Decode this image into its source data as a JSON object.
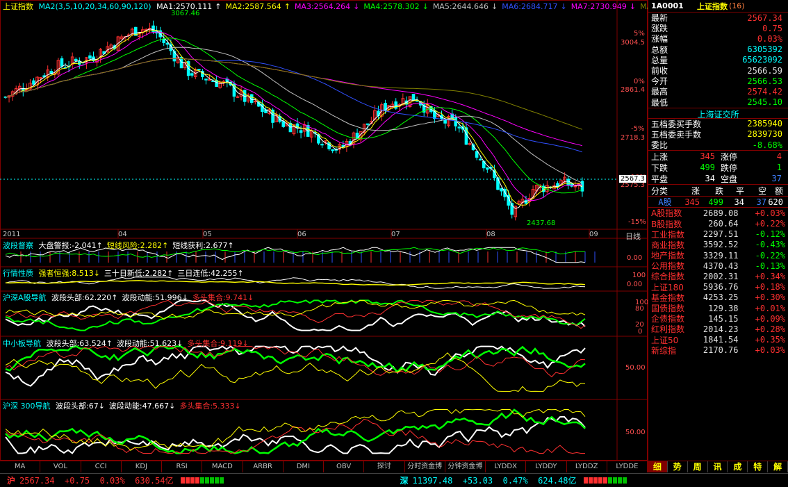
{
  "main_chart": {
    "title": "上证指数",
    "ma_params": "MA2(3,5,10,20,34,60,90,120)",
    "ma_items": [
      {
        "label": "MA1:2570.111",
        "arrow": "↑",
        "color": "#ffffff"
      },
      {
        "label": "MA2:2587.564",
        "arrow": "↑",
        "color": "#ffff00"
      },
      {
        "label": "MA3:2564.264",
        "arrow": "↓",
        "color": "#ff00ff"
      },
      {
        "label": "MA4:2578.302",
        "arrow": "↓",
        "color": "#00ff00"
      },
      {
        "label": "MA5:2644.646",
        "arrow": "↓",
        "color": "#c0c0c0"
      },
      {
        "label": "MA6:2684.717",
        "arrow": "↓",
        "color": "#3050ff"
      },
      {
        "label": "MA7:2730.949",
        "arrow": "↓",
        "color": "#ff00ff"
      },
      {
        "label": "MA8:2792.803",
        "arrow": "↓",
        "color": "#808000"
      }
    ],
    "high_mark": "3067.46",
    "low_mark": "2437.68",
    "current_mark": "2567.3",
    "y_ticks": [
      {
        "pct": "5%",
        "price": "3004.5"
      },
      {
        "pct": "0%",
        "price": "2861.4"
      },
      {
        "pct": "-5%",
        "price": "2718.3"
      },
      {
        "pct": "-10%",
        "price": "2575.3"
      },
      {
        "pct": "-15%",
        "price": ""
      }
    ],
    "date_labels": [
      "2011",
      "04",
      "05",
      "06",
      "07",
      "08",
      "09"
    ],
    "axis_suffix": "日线"
  },
  "panels": {
    "bodo": {
      "title": "波段督察",
      "items": [
        {
          "label": "大盘警报:-2.041",
          "arrow": "↑",
          "color": "#ffffff"
        },
        {
          "label": "短线风险:2.282",
          "arrow": "↑",
          "color": "#ffff00"
        },
        {
          "label": "短线获利:2.677",
          "arrow": "↑",
          "color": "#ffffff"
        }
      ],
      "axis": "0.00"
    },
    "hangqing": {
      "title": "行情性质",
      "items": [
        {
          "label": "强者恒强:8.513",
          "arrow": "↓",
          "color": "#ffff00"
        },
        {
          "label": "三十日新低:2.282",
          "arrow": "↑",
          "color": "#ffffff"
        },
        {
          "label": "三日连低:42.255",
          "arrow": "↑",
          "color": "#ffffff"
        }
      ],
      "axis": [
        "100",
        "0.00"
      ]
    },
    "hushen_a": {
      "title": "沪深A股导航",
      "items": [
        {
          "label": "波段头部:62.220",
          "arrow": "↑",
          "color": "#ffffff"
        },
        {
          "label": "波段动能:51.996",
          "arrow": "↓",
          "color": "#ffffff"
        },
        {
          "label": "多头集合:9.741",
          "arrow": "↓",
          "color": "#ff3030"
        }
      ],
      "axis": [
        "100",
        "80",
        "20",
        "0"
      ]
    },
    "zhongxiao": {
      "title": "中小板导航",
      "items": [
        {
          "label": "波段头部:63.524",
          "arrow": "↑",
          "color": "#ffffff"
        },
        {
          "label": "波段动能:51.623",
          "arrow": "↓",
          "color": "#ffffff"
        },
        {
          "label": "多头集合:9.119",
          "arrow": "↓",
          "color": "#ff3030"
        }
      ],
      "axis": "50.00"
    },
    "hs300": {
      "title": "沪深 300导航",
      "items": [
        {
          "label": "波段头部:67",
          "arrow": "↓",
          "color": "#ffffff"
        },
        {
          "label": "波段动能:47.667",
          "arrow": "↓",
          "color": "#ffffff"
        },
        {
          "label": "多头集合:5.333",
          "arrow": "↓",
          "color": "#ff3030"
        }
      ],
      "axis": "50.00"
    }
  },
  "quote": {
    "code": "1A0001",
    "name": "上证指数",
    "count": "(16)",
    "rows": [
      {
        "label": "最新",
        "value": "2567.34",
        "color": "#ff3030"
      },
      {
        "label": "涨跌",
        "value": "0.75",
        "color": "#ff3030"
      },
      {
        "label": "涨幅",
        "value": "0.03%",
        "color": "#ff3030"
      },
      {
        "label": "总额",
        "value": "6305392",
        "color": "#00ffff"
      },
      {
        "label": "总量",
        "value": "65623092",
        "color": "#00ffff"
      },
      {
        "label": "前收",
        "value": "2566.59",
        "color": "#e0e0e0"
      },
      {
        "label": "今开",
        "value": "2566.53",
        "color": "#00ff00"
      },
      {
        "label": "最高",
        "value": "2574.42",
        "color": "#ff3030"
      },
      {
        "label": "最低",
        "value": "2545.10",
        "color": "#00ff00"
      }
    ],
    "exchange": "上海证交所",
    "orders": [
      {
        "label": "五档委买手数",
        "value": "2385940",
        "color": "#ffff00"
      },
      {
        "label": "五档委卖手数",
        "value": "2839730",
        "color": "#ffff00"
      },
      {
        "label": "委比",
        "value": "-8.68%",
        "color": "#00ff00"
      }
    ],
    "updown": [
      {
        "l1": "上涨",
        "v1": "345",
        "c1": "#ff3030",
        "l2": "涨停",
        "v2": "4",
        "c2": "#ff3030"
      },
      {
        "l1": "下跌",
        "v1": "499",
        "c1": "#00ff00",
        "l2": "跌停",
        "v2": "1",
        "c2": "#00ff00"
      },
      {
        "l1": "平盘",
        "v1": "34",
        "c1": "#ffffff",
        "l2": "空盘",
        "v2": "37",
        "c2": "#4080ff"
      }
    ],
    "class_header": [
      "分类",
      "涨",
      "跌",
      "平",
      "空",
      "额"
    ],
    "class_row": {
      "label": "A股",
      "up": "345",
      "down": "499",
      "flat": "34",
      "empty": "37",
      "amount": "620"
    },
    "indices": [
      {
        "name": "A股指数",
        "value": "2689.08",
        "pct": "+0.03%"
      },
      {
        "name": "B股指数",
        "value": "260.64",
        "pct": "+0.22%"
      },
      {
        "name": "工业指数",
        "value": "2297.51",
        "pct": "-0.12%"
      },
      {
        "name": "商业指数",
        "value": "3592.52",
        "pct": "-0.43%"
      },
      {
        "name": "地产指数",
        "value": "3329.11",
        "pct": "-0.22%"
      },
      {
        "name": "公用指数",
        "value": "4370.43",
        "pct": "-0.13%"
      },
      {
        "name": "综合指数",
        "value": "2002.31",
        "pct": "+0.34%"
      },
      {
        "name": "上证180",
        "value": "5936.76",
        "pct": "+0.18%"
      },
      {
        "name": "基金指数",
        "value": "4253.25",
        "pct": "+0.30%"
      },
      {
        "name": "国债指数",
        "value": "129.38",
        "pct": "+0.01%"
      },
      {
        "name": "企债指数",
        "value": "145.15",
        "pct": "+0.09%"
      },
      {
        "name": "红利指数",
        "value": "2014.23",
        "pct": "+0.28%"
      },
      {
        "name": "上证50",
        "value": "1841.54",
        "pct": "+0.35%"
      },
      {
        "name": "新综指",
        "value": "2170.76",
        "pct": "+0.03%"
      }
    ]
  },
  "tabs": [
    "MA",
    "VOL",
    "CCI",
    "KDJ",
    "RSI",
    "MACD",
    "ARBR",
    "DMI",
    "OBV",
    "探讨",
    "分时资金博",
    "分钟资金博",
    "LYDDX",
    "LYDDY",
    "LYDDZ",
    "LYDDE"
  ],
  "side_tabs": [
    "细",
    "势",
    "周",
    "讯",
    "成",
    "特",
    "解"
  ],
  "status": {
    "sh_label": "沪",
    "sh_values": "2567.34  +0.75  0.03%  630.54亿",
    "sz_label": "深",
    "sz_values": "11397.48  +53.03  0.47%  624.48亿"
  },
  "colors": {
    "up": "#ff3030",
    "down": "#00ffff",
    "bg": "#000000",
    "border": "#800000"
  }
}
